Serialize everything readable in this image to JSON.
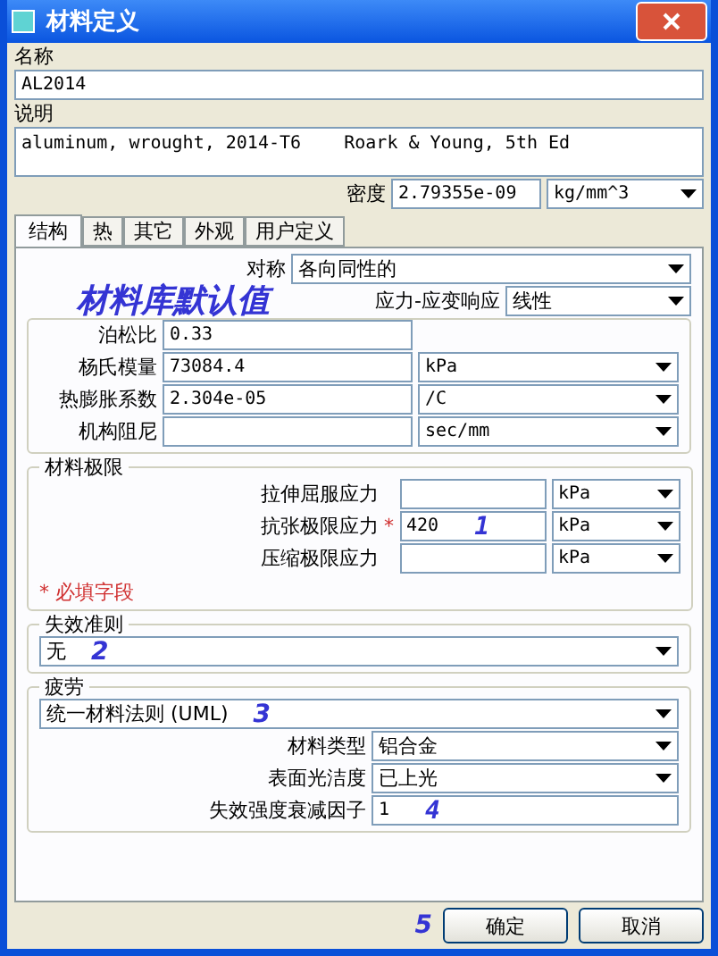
{
  "window": {
    "title": "材料定义"
  },
  "name": {
    "label": "名称",
    "value": "AL2014"
  },
  "description": {
    "label": "说明",
    "value": "aluminum, wrought, 2014-T6    Roark & Young, 5th Ed"
  },
  "density": {
    "label": "密度",
    "value": "2.79355e-09",
    "unit": "kg/mm^3"
  },
  "tabs": [
    {
      "label": "结构",
      "selected": true
    },
    {
      "label": "热",
      "selected": false
    },
    {
      "label": "其它",
      "selected": false
    },
    {
      "label": "外观",
      "selected": false
    },
    {
      "label": "用户定义",
      "selected": false
    }
  ],
  "symmetry": {
    "label": "对称",
    "value": "各向同性的"
  },
  "main_annotation": "材料库默认值",
  "stress_strain": {
    "label": "应力-应变响应",
    "value": "线性"
  },
  "properties": [
    {
      "label": "泊松比",
      "value": "0.33"
    },
    {
      "label": "杨氏模量",
      "value": "73084.4",
      "unit": "kPa"
    },
    {
      "label": "热膨胀系数",
      "value": "2.304e-05",
      "unit": "/C"
    },
    {
      "label": "机构阻尼",
      "unit": "sec/mm"
    }
  ],
  "limits": {
    "title": "材料极限",
    "rows": [
      {
        "label": "拉伸屈服应力",
        "unit": "kPa"
      },
      {
        "label": "抗张极限应力",
        "marker": "*",
        "value": "420",
        "note": "1",
        "unit": "kPa"
      },
      {
        "label": "压缩极限应力",
        "unit": "kPa"
      }
    ],
    "required_note": "* 必填字段"
  },
  "failure": {
    "title": "失效准则",
    "value": "无",
    "note": "2"
  },
  "fatigue": {
    "title": "疲劳",
    "value": "统一材料法则 (UML)",
    "note": "3",
    "rows": [
      {
        "kind": "select",
        "label": "材料类型",
        "value": "铝合金"
      },
      {
        "kind": "select",
        "label": "表面光洁度",
        "value": "已上光"
      },
      {
        "kind": "input",
        "label": "失效强度衰减因子",
        "value": "1",
        "note": "4"
      }
    ]
  },
  "buttons_note": "5",
  "buttons": [
    {
      "label": "确定"
    },
    {
      "label": "取消"
    }
  ]
}
